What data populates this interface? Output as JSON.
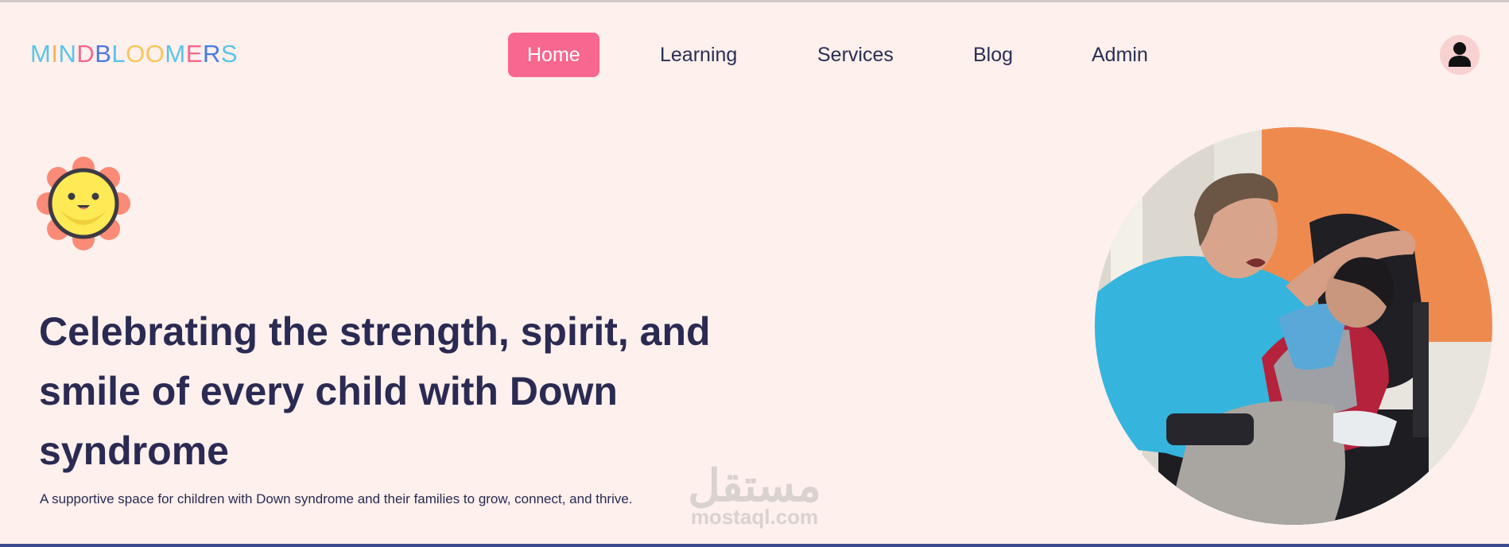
{
  "logo": {
    "letters": [
      "M",
      "I",
      "N",
      "D",
      "B",
      "L",
      "O",
      "O",
      "M",
      "E",
      "R",
      "S"
    ],
    "colors": [
      "#5bc4e8",
      "#f7b45a",
      "#5bc4e8",
      "#f8678e",
      "#4a7be3",
      "#5bc4e8",
      "#f7c65a",
      "#f7c65a",
      "#5bc4e8",
      "#f8678e",
      "#4a7be3",
      "#5bc4e8"
    ]
  },
  "nav": {
    "items": [
      {
        "label": "Home",
        "active": true
      },
      {
        "label": "Learning",
        "active": false
      },
      {
        "label": "Services",
        "active": false
      },
      {
        "label": "Blog",
        "active": false
      },
      {
        "label": "Admin",
        "active": false
      }
    ]
  },
  "hero": {
    "headline": "Celebrating the strength, spirit, and smile of every child with Down syndrome",
    "subtitle": "A supportive space for children with Down syndrome and their families to grow, connect, and thrive."
  },
  "watermark": {
    "arabic": "مستقل",
    "latin": "mostaql.com"
  },
  "colors": {
    "background": "#fdf0ed",
    "accent": "#f8678e",
    "text": "#2b2a52"
  },
  "icons": {
    "avatar": "user-avatar-icon",
    "mascot": "smiling-sun-icon"
  }
}
